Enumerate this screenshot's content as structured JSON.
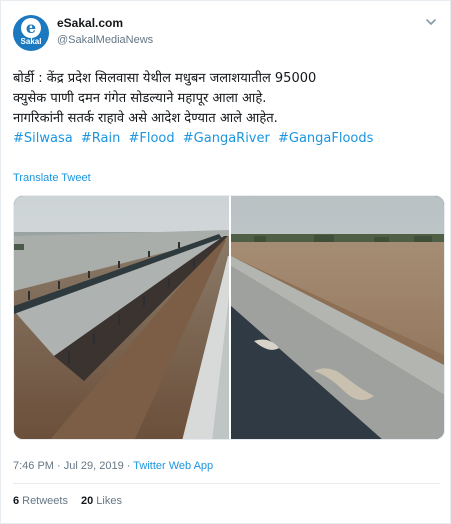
{
  "account": {
    "display_name": "eSakal.com",
    "handle": "@SakalMediaNews",
    "avatar_letter": "e",
    "avatar_word": "Sakal"
  },
  "tweet": {
    "lines": [
      "बोर्डी : केंद्र प्रदेश सिलवासा येथील मधुबन जलाशयातील 95000",
      "क्युसेक पाणी दमन गंगेत सोडल्याने महापूर आला आहे.",
      "नागरिकांनी सतर्क राहावे असे आदेश देण्यात आले आहेत."
    ],
    "hashtags": [
      "#Silwasa",
      "#Rain",
      "#Flood",
      "#GangaRiver",
      "#GangaFloods"
    ],
    "translate_label": "Translate Tweet"
  },
  "media": {
    "photos": [
      "flooded-causeway-photo",
      "flooded-river-embankment-photo"
    ]
  },
  "meta": {
    "time": "7:46 PM",
    "separator": " · ",
    "date": "Jul 29, 2019",
    "app": "Twitter Web App"
  },
  "stats": {
    "retweets_count": "6",
    "retweets_label": "Retweets",
    "likes_count": "20",
    "likes_label": "Likes"
  },
  "colors": {
    "accent": "#1b95e0",
    "brand_avatar": "#1c79c0",
    "muted": "#657786",
    "text": "#14171a"
  }
}
